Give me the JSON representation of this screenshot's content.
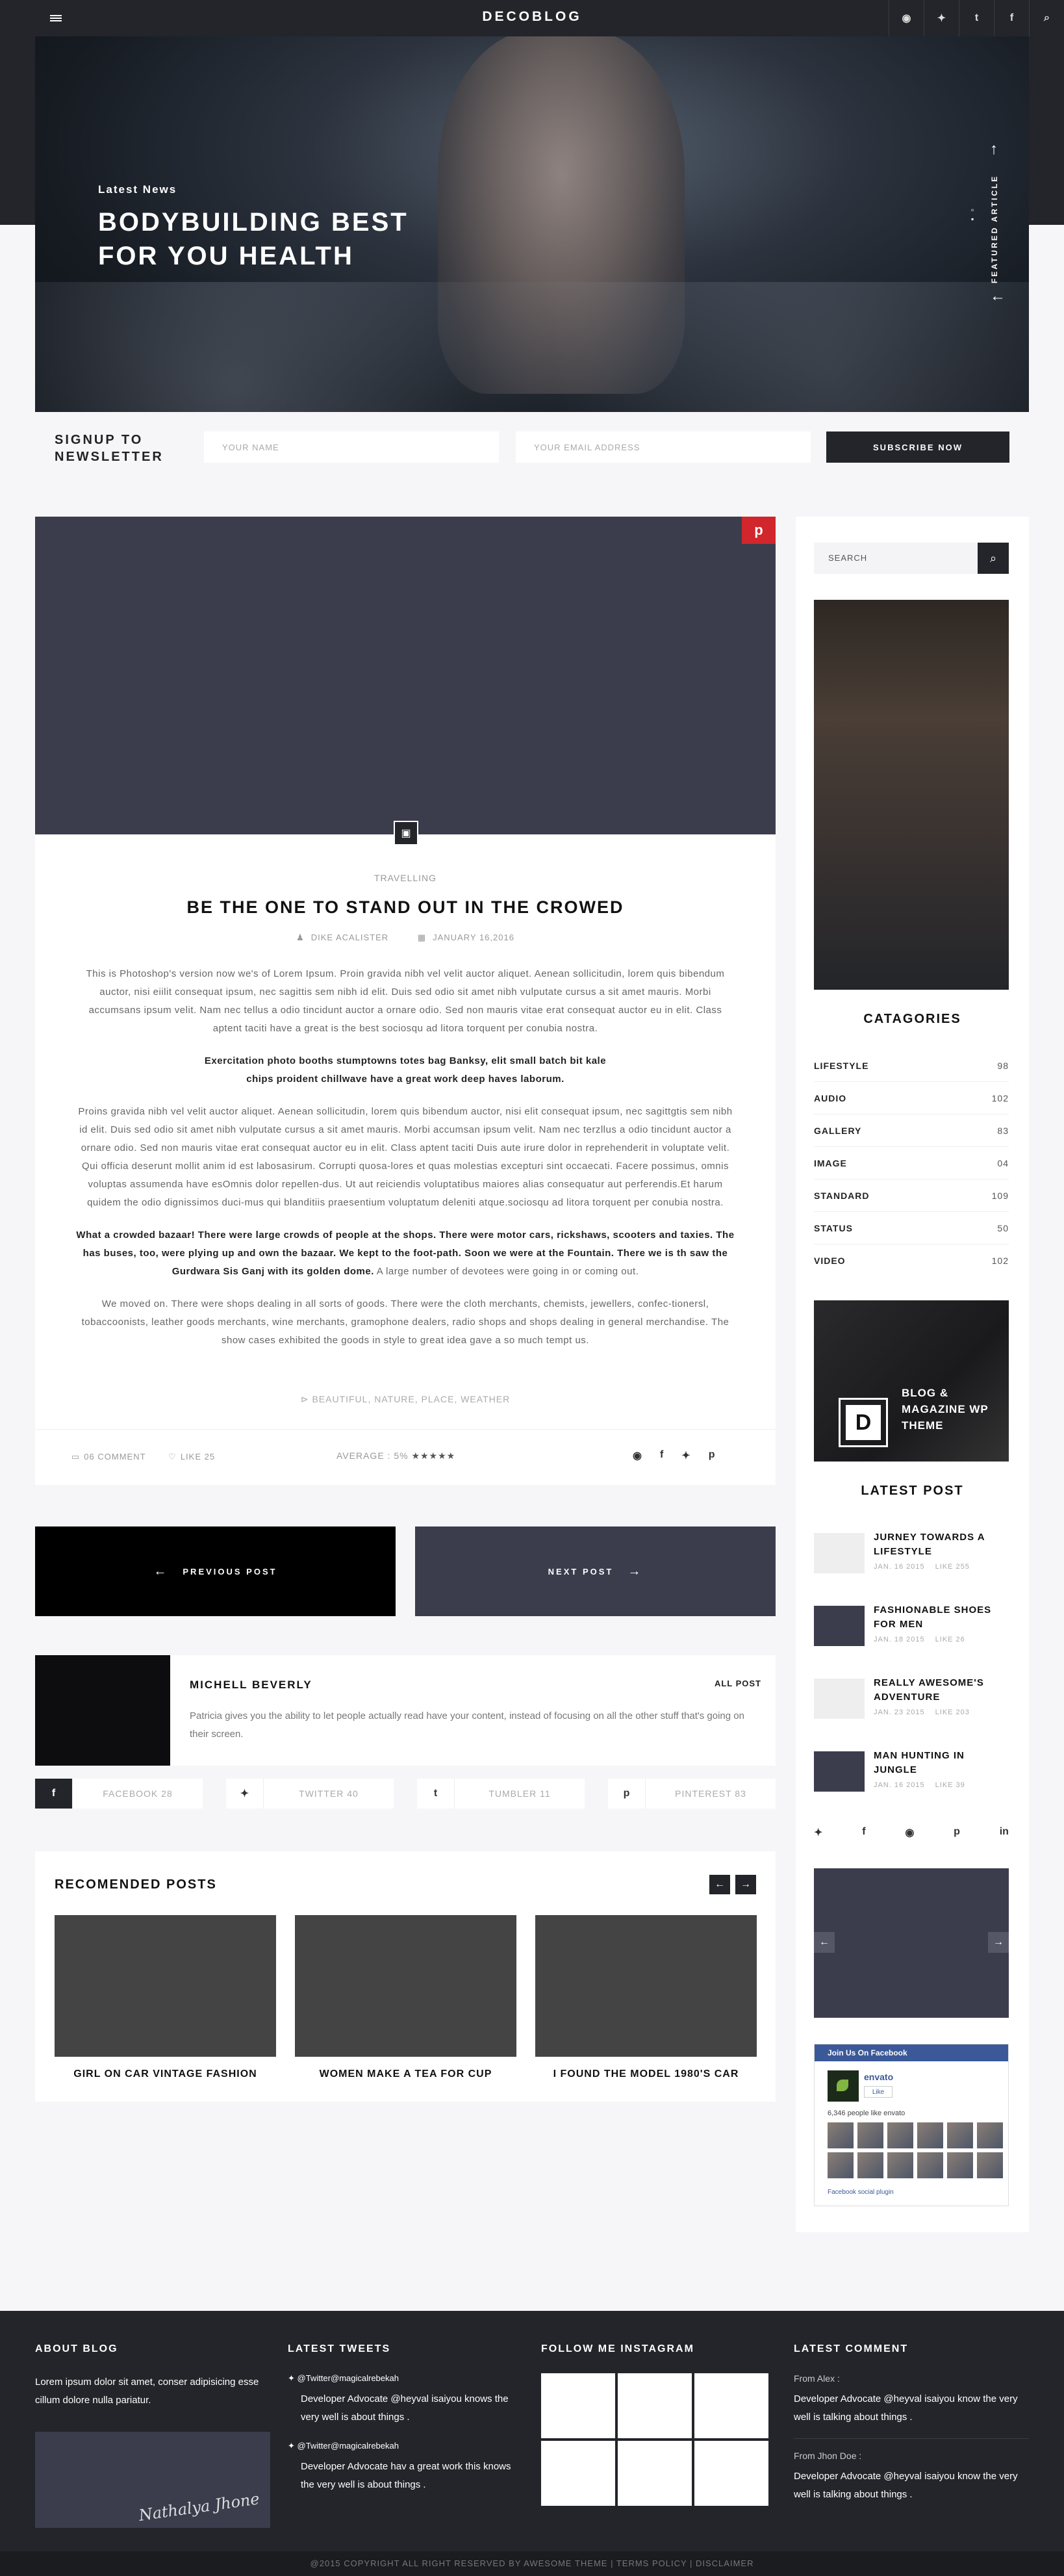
{
  "nav": {
    "logo": "DECOBLOG",
    "icons": [
      "rss-icon",
      "twitter-icon",
      "tumblr-icon",
      "facebook-icon",
      "search-icon"
    ],
    "icon_glyphs": [
      "◉",
      "✦",
      "t",
      "f",
      "⌕"
    ]
  },
  "hero": {
    "kicker": "Latest News",
    "title": "BODYBUILDING BEST FOR YOU HEALTH",
    "side_label": "FEATURED ARTICLE"
  },
  "newsletter": {
    "label": "SIGNUP TO NEWSLETTER",
    "name_placeholder": "YOUR NAME",
    "email_placeholder": "YOUR EMAIL ADDRESS",
    "button": "SUBSCRIBE NOW"
  },
  "article": {
    "category": "TRAVELLING",
    "title": "BE THE ONE TO STAND OUT IN THE CROWED",
    "author": "DIKE ACALISTER",
    "date": "JANUARY 16,2016",
    "paragraphs": [
      "This is Photoshop's version now we's of Lorem Ipsum. Proin gravida nibh vel velit auctor aliquet. Aenean sollicitudin, lorem quis bibendum auctor, nisi eiilit consequat ipsum, nec sagittis sem nibh id elit. Duis sed odio sit amet nibh vulputate cursus a sit amet mauris. Morbi accumsans ipsum velit. Nam nec tellus a odio tincidunt auctor a ornare odio. Sed non  mauris vitae erat consequat auctor eu in elit. Class aptent taciti  have a great is the best sociosqu ad litora torquent per conubia nostra.",
      "Proins gravida nibh vel velit auctor aliquet. Aenean sollicitudin, lorem quis bibendum auctor, nisi elit consequat ipsum, nec sagittgtis sem nibh id elit. Duis sed odio sit amet nibh vulputate cursus a sit amet mauris. Morbi accumsan ipsum velit. Nam nec terzllus a odio tincidunt auctor a ornare odio. Sed non  mauris vitae erat consequat auctor eu in elit. Class aptent taciti Duis aute irure dolor in reprehenderit in voluptate velit. Qui officia deserunt mollit anim id est labosasirum. Corrupti quosa-lores et quas molestias excepturi sint occaecati. Facere possimus, omnis voluptas assumenda have esOmnis dolor repellen-dus. Ut aut reiciendis voluptatibus maiores alias consequatur aut perferendis.Et harum quidem the odio dignissimos duci-mus qui blanditiis praesentium voluptatum deleniti atque.sociosqu ad litora torquent per conubia nostra.",
      "We moved on. There were shops dealing in all sorts of goods. There were the cloth merchants, chemists, jewellers, confec-tionersl, tobaccoonists, leather goods merchants, wine merchants, gramophone dealers, radio shops and shops dealing in general merchandise. The show cases exhibited the goods in style to great idea gave a so much tempt us."
    ],
    "quote": "Exercitation photo booths stumptowns totes bag Banksy, elit small batch bit kale chips proident chillwave have a great work deep haves laborum.",
    "highlight_bold": "What a crowded bazaar! There were large crowds of people at the shops. There were motor cars, rickshaws, scooters and taxies. The has buses, too, were plying up and own the bazaar. We kept to the foot-path. Soon we were at the Fountain. There we is th saw the Gurdwara Sis Ganj with its golden dome.",
    "highlight_tail": " A large number of devotees were going in or coming out.",
    "tags": "BEAUTIFUL, NATURE, PLACE, WEATHER",
    "comments": "06 COMMENT",
    "likes": "LIKE 25",
    "average": "AVERAGE : 5%",
    "rating": "★★★★★"
  },
  "postnav": {
    "prev": "PREVIOUS POST",
    "next": "NEXT POST"
  },
  "author": {
    "name": "MICHELL BEVERLY",
    "all_post": "ALL POST",
    "bio": "Patricia gives you the ability to let people actually read have your content, instead of focusing on all the other stuff that's going on their screen."
  },
  "share": [
    {
      "icon": "facebook-icon",
      "glyph": "f",
      "label": "FACEBOOK 28"
    },
    {
      "icon": "twitter-icon",
      "glyph": "✦",
      "label": "TWITTER 40"
    },
    {
      "icon": "tumblr-icon",
      "glyph": "t",
      "label": "TUMBLER 11"
    },
    {
      "icon": "pinterest-icon",
      "glyph": "p",
      "label": "PINTEREST 83"
    }
  ],
  "recommended": {
    "title": "RECOMENDED POSTS",
    "items": [
      "GIRL ON CAR VINTAGE FASHION",
      "WOMEN MAKE A TEA FOR CUP",
      "I FOUND THE MODEL 1980'S CAR"
    ]
  },
  "sidebar": {
    "search_placeholder": "SEARCH",
    "categories_title": "CATAGORIES",
    "categories": [
      {
        "name": "LIFESTYLE",
        "count": "98"
      },
      {
        "name": "AUDIO",
        "count": "102"
      },
      {
        "name": "GALLERY",
        "count": "83"
      },
      {
        "name": "IMAGE",
        "count": "04"
      },
      {
        "name": "STANDARD",
        "count": "109"
      },
      {
        "name": "STATUS",
        "count": "50"
      },
      {
        "name": "VIDEO",
        "count": "102"
      }
    ],
    "ad": {
      "letter": "D",
      "text": "BLOG & MAGAZINE WP THEME"
    },
    "latest_title": "LATEST POST",
    "latest": [
      {
        "title": "JURNEY TOWARDS A LIFESTYLE",
        "date": "JAN. 16 2015",
        "likes": "LIKE 255",
        "thumb": "light"
      },
      {
        "title": "FASHIONABLE SHOES FOR MEN",
        "date": "JAN. 18 2015",
        "likes": "LIKE 26",
        "thumb": "dark"
      },
      {
        "title": "REALLY AWESOME'S ADVENTURE",
        "date": "JAN. 23 2015",
        "likes": "LIKE 203",
        "thumb": "light"
      },
      {
        "title": "MAN HUNTING IN JUNGLE",
        "date": "JAN. 16 2015",
        "likes": "LIKE 39",
        "thumb": "dark"
      }
    ],
    "social_glyphs": [
      "✦",
      "f",
      "◉",
      "p",
      "in"
    ],
    "facebook": {
      "header": "Join Us On Facebook",
      "name": "envato",
      "like": "Like",
      "count": "6,346 people like envato",
      "plugin": "Facebook social plugin"
    }
  },
  "footer": {
    "about_title": "ABOUT BLOG",
    "about_text": "Lorem ipsum dolor sit amet, conser adipisicing esse cillum dolore nulla pariatur.",
    "signature": "Nathalya Jhone",
    "tweets_title": "LATEST TWEETS",
    "tweets": [
      {
        "handle": "@Twitter@magicalrebekah",
        "body": "Developer Advocate @heyval isaiyou knows the very well is about things ."
      },
      {
        "handle": "@Twitter@magicalrebekah",
        "body": "Developer Advocate hav a great work this knows the very well is about things ."
      }
    ],
    "instagram_title": "FOLLOW ME INSTAGRAM",
    "comments_title": "LATEST COMMENT",
    "comments": [
      {
        "from": "From Alex :",
        "body": "Developer Advocate @heyval isaiyou know the very well is talking about things ."
      },
      {
        "from": "From Jhon Doe :",
        "body": "Developer Advocate @heyval isaiyou know the very well is talking about things ."
      }
    ],
    "copyright": "@2015 COPYRIGHT  ALL RIGHT RESERVED BY AWESOME THEME   |   TERMS POLICY   |   DISCLAIMER"
  }
}
